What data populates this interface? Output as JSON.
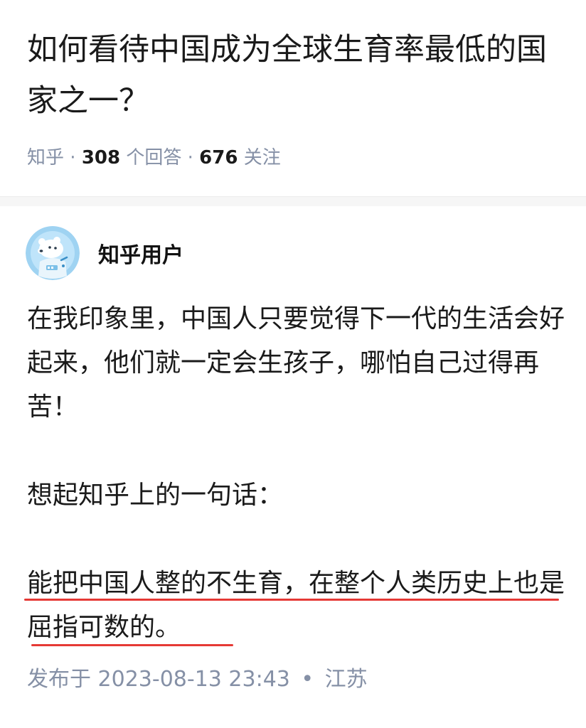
{
  "question": {
    "title": "如何看待中国成为全球生育率最低的国家之一？",
    "source": "知乎",
    "answer_count": "308",
    "answer_label": "个回答",
    "follow_count": "676",
    "follow_label": "关注"
  },
  "answer": {
    "author_name": "知乎用户",
    "avatar_icon": "zhihu-default-avatar-icon",
    "paragraphs": [
      "在我印象里，中国人只要觉得下一代的生活会好起来，他们就一定会生孩子，哪怕自己过得再苦！",
      "想起知乎上的一句话：",
      "能把中国人整的不生育，在整个人类历史上也是屈指可数的。"
    ],
    "highlight_color": "#e53935",
    "published_label": "发布于 2023-08-13 23:43",
    "location": "江苏"
  },
  "colors": {
    "meta_gray": "#8590a6",
    "text": "#1a1a1a",
    "background": "#f6f6f6"
  }
}
